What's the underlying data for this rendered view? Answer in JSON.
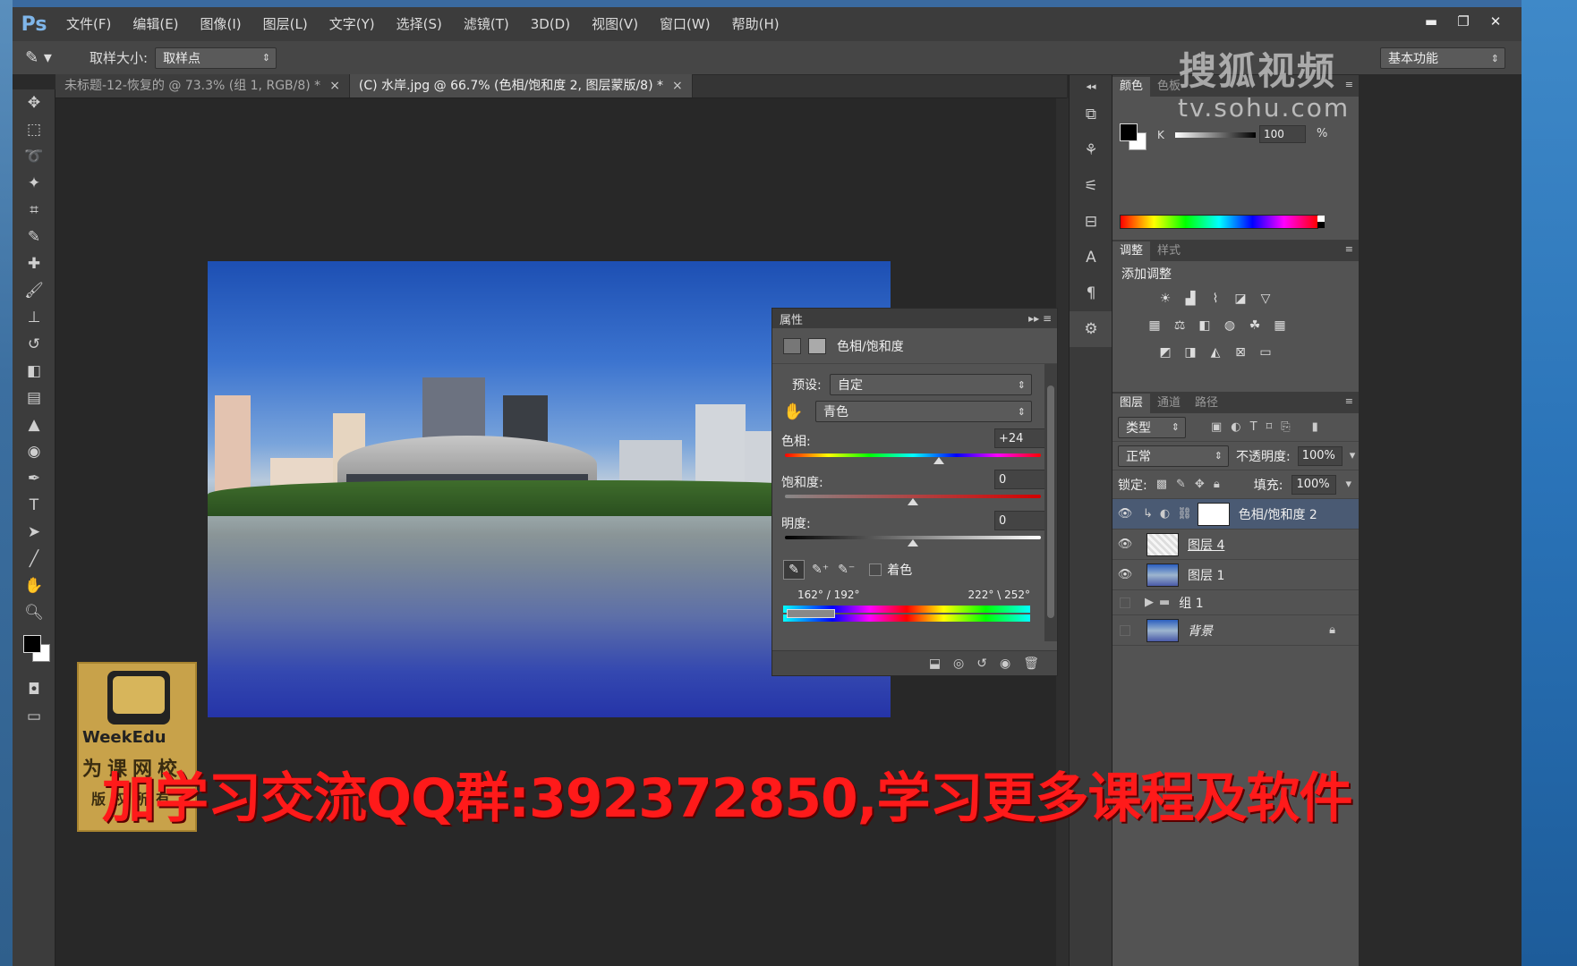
{
  "app": {
    "logo": "Ps"
  },
  "menu": [
    "文件(F)",
    "编辑(E)",
    "图像(I)",
    "图层(L)",
    "文字(Y)",
    "选择(S)",
    "滤镜(T)",
    "3D(D)",
    "视图(V)",
    "窗口(W)",
    "帮助(H)"
  ],
  "window_controls": {
    "minimize": "▬",
    "maximize": "❐",
    "close": "✕"
  },
  "options": {
    "sample_label": "取样大小:",
    "sample_value": "取样点",
    "workspace": "基本功能"
  },
  "doc_tabs": [
    {
      "label": "未标题-12-恢复的 @ 73.3% (组 1, RGB/8) *",
      "close": "×"
    },
    {
      "label": "(C) 水岸.jpg @ 66.7% (色相/饱和度 2, 图层蒙版/8) *",
      "close": "×"
    }
  ],
  "properties": {
    "panel_title": "属性",
    "adjustment_title": "色相/饱和度",
    "preset_label": "预设:",
    "preset_value": "自定",
    "channel_value": "青色",
    "hue_label": "色相:",
    "hue_value": "+24",
    "hue_level": 0.6,
    "saturation_label": "饱和度:",
    "saturation_value": "0",
    "saturation_level": 0.5,
    "lightness_label": "明度:",
    "lightness_value": "0",
    "lightness_level": 0.5,
    "colorize_label": "着色",
    "range_left": "162° / 192°",
    "range_right": "222° \\ 252°"
  },
  "color_panel": {
    "tabs": [
      "颜色",
      "色板"
    ],
    "k_label": "K",
    "k_value": "100",
    "k_unit": "%"
  },
  "adjustments_panel": {
    "tabs": [
      "调整",
      "样式"
    ],
    "title": "添加调整"
  },
  "layers_panel": {
    "tabs": [
      "图层",
      "通道",
      "路径"
    ],
    "filter_value": "类型",
    "blend_mode": "正常",
    "opacity_label": "不透明度:",
    "opacity_value": "100%",
    "lock_label": "锁定:",
    "fill_label": "填充:",
    "fill_value": "100%",
    "layers": [
      {
        "name": "色相/饱和度 2",
        "visible": true,
        "selected": true
      },
      {
        "name": "图层 4",
        "visible": true,
        "selected": false
      },
      {
        "name": "图层 1",
        "visible": true,
        "selected": false
      },
      {
        "name": "组 1",
        "visible": false,
        "selected": false
      },
      {
        "name": "背景",
        "visible": false,
        "selected": false
      }
    ]
  },
  "watermarks": {
    "sohu": "搜狐视频",
    "sohu_url": "tv.sohu.com",
    "weekedu_name": "WeekEdu",
    "weekedu_line1": "为课网校",
    "weekedu_line2": "版权所有",
    "banner": "加学习交流QQ群:392372850,学习更多课程及软件"
  }
}
